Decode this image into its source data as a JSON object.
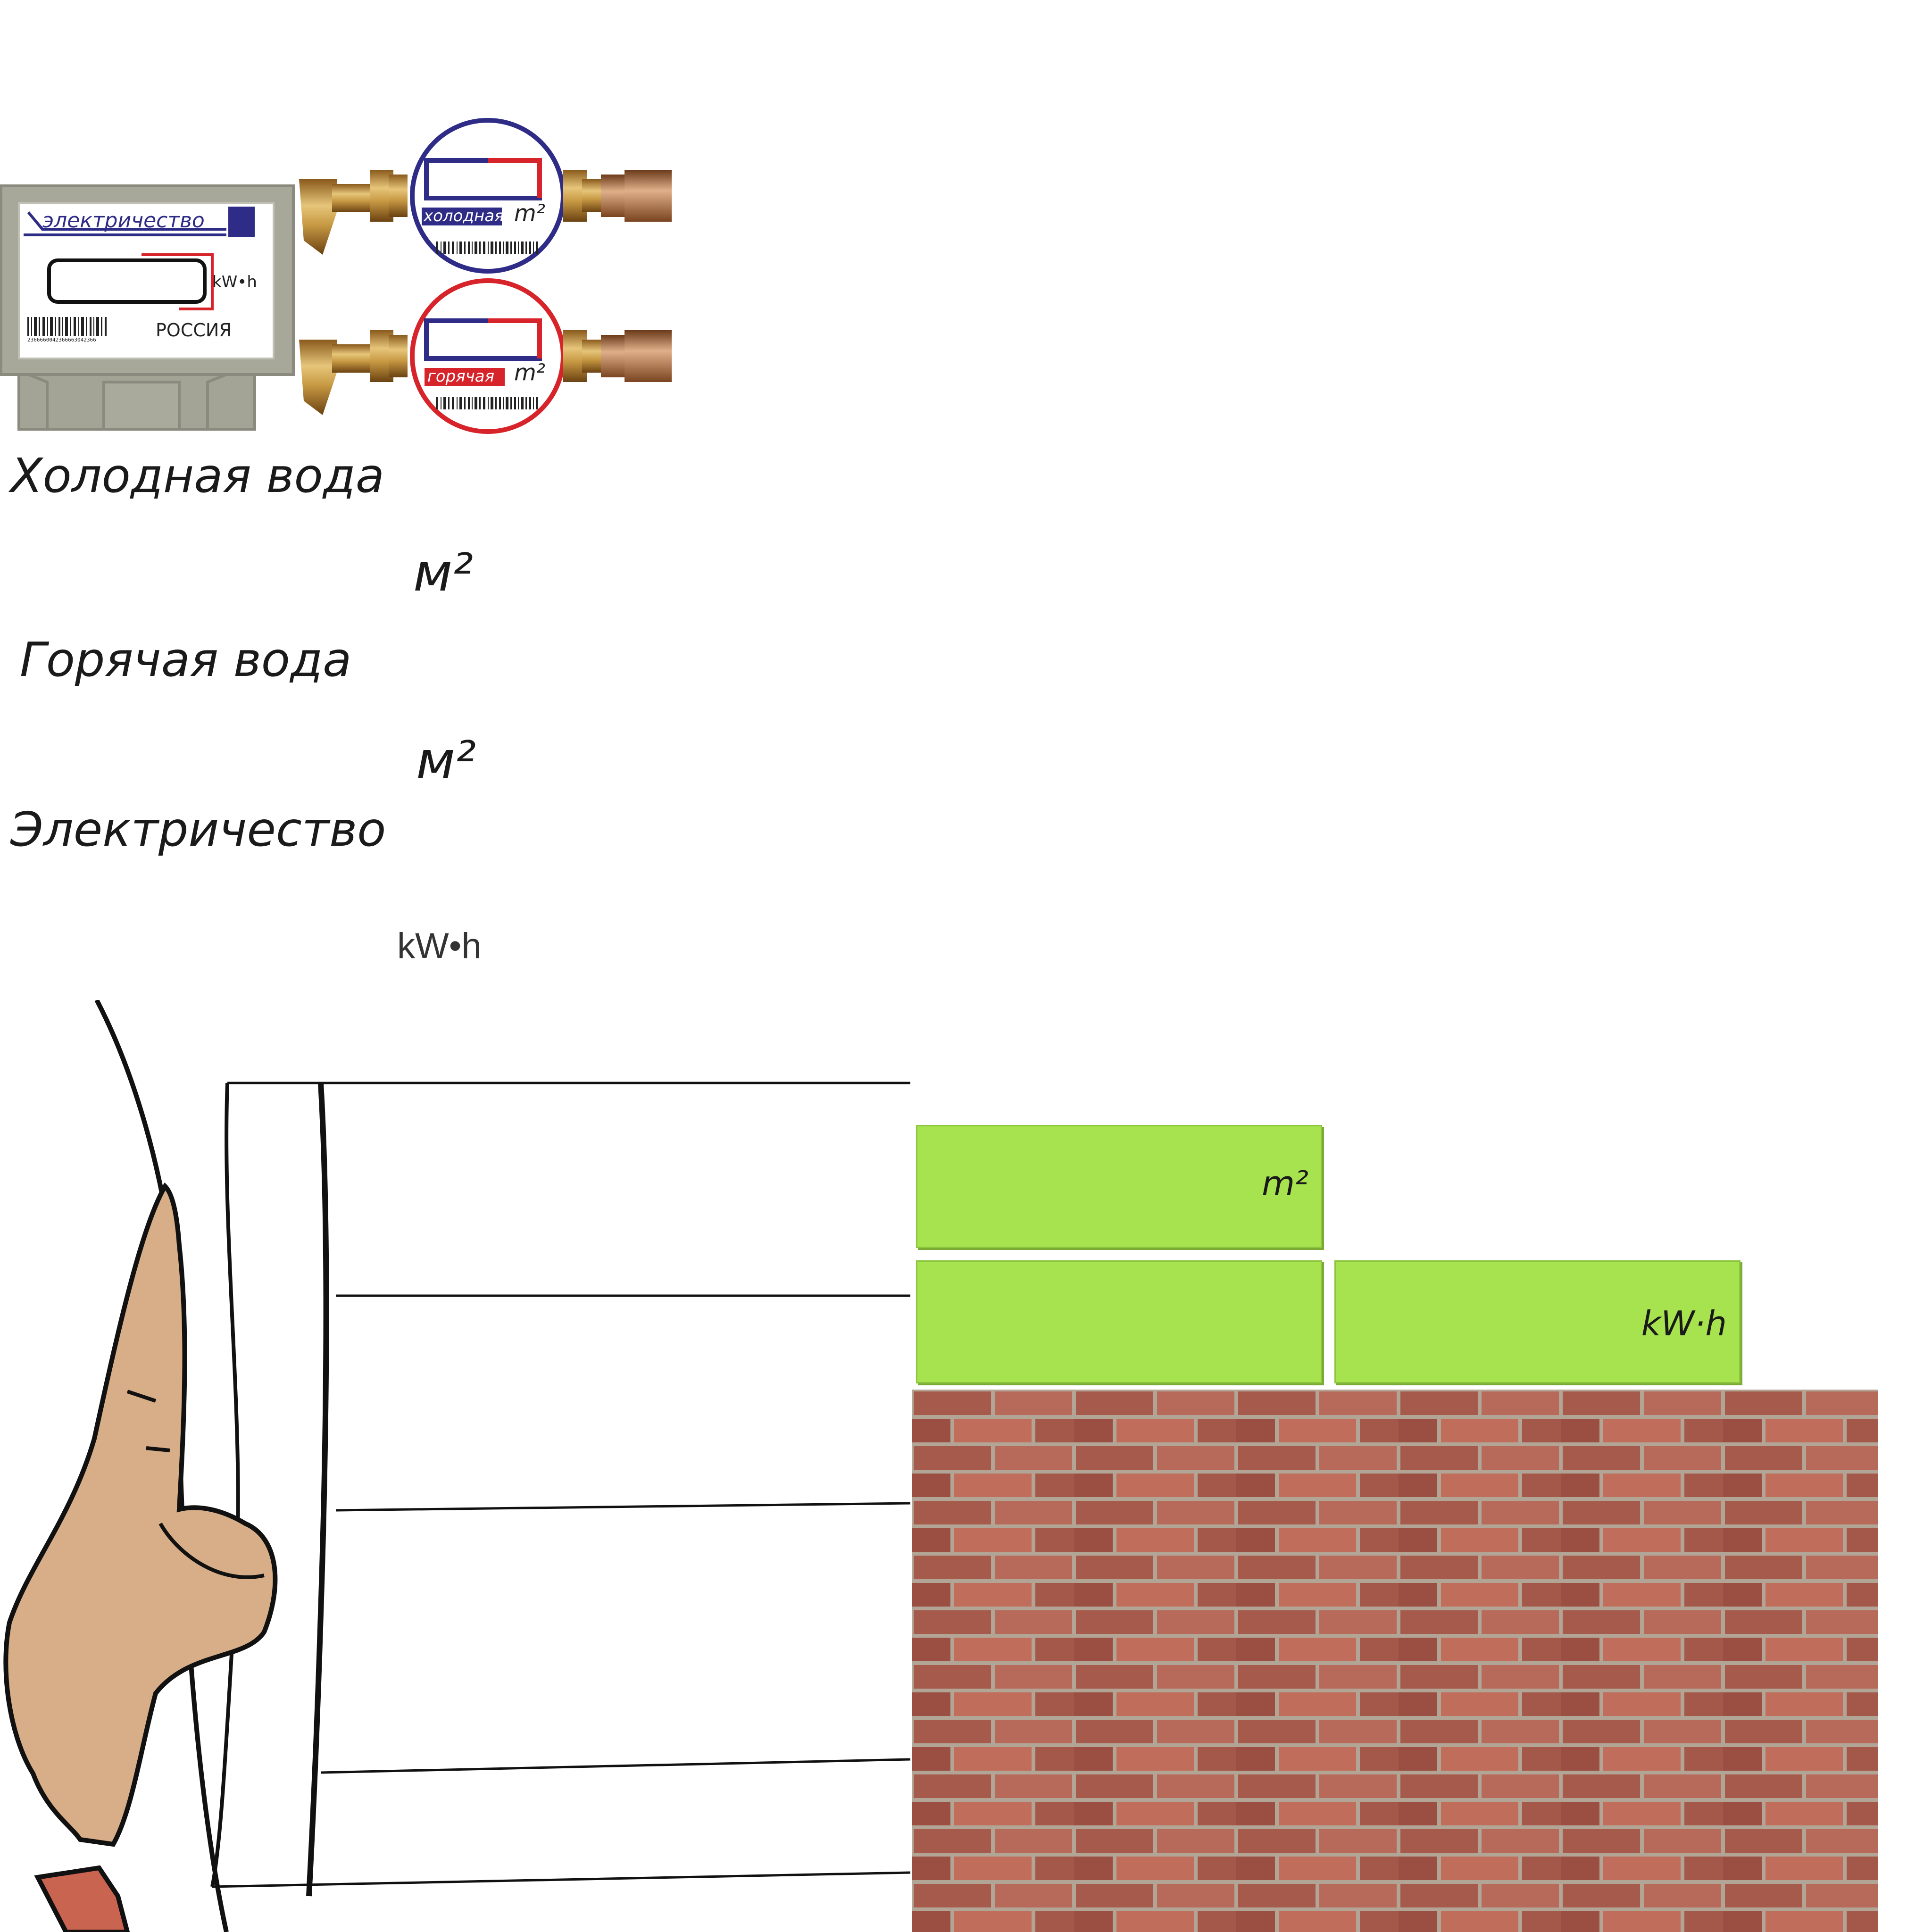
{
  "meters": {
    "electric": {
      "brand": "электричество",
      "unit": "kW•h",
      "country": "РОССИЯ",
      "barcode_number": "2366660042366663042366"
    },
    "cold": {
      "label": "холодная",
      "unit": "m²"
    },
    "hot": {
      "label": "горячая",
      "unit": "m²"
    }
  },
  "readings": {
    "cold_title": "Холодная вода",
    "cold_unit": "м²",
    "hot_title": "Горячая вода",
    "hot_unit": "м²",
    "electric_title": "Электричество",
    "electric_unit": "kW•h"
  },
  "panels": {
    "top_unit": "m²",
    "right_unit": "kW·h"
  },
  "colors": {
    "cold_accent": "#2e2c86",
    "hot_accent": "#d7232a",
    "panel_green": "#a6e34e",
    "brick": "#a0584c",
    "meter_body": "#9e9e8e",
    "skin": "#d7ae87"
  }
}
